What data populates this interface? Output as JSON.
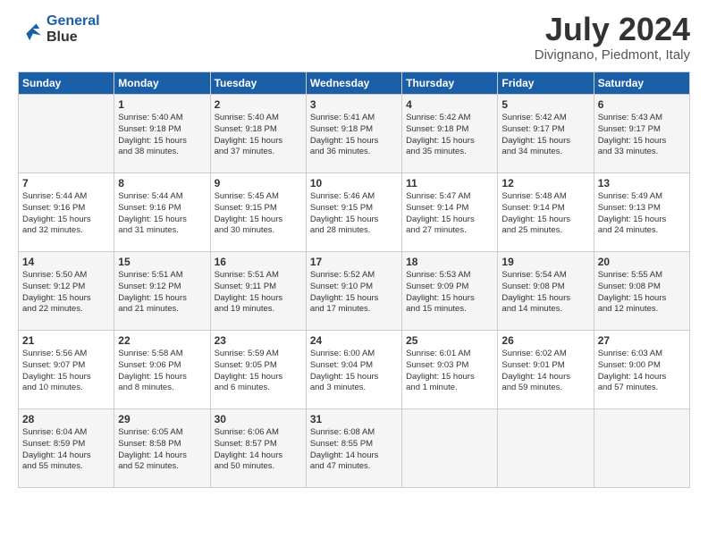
{
  "header": {
    "logo_line1": "General",
    "logo_line2": "Blue",
    "title": "July 2024",
    "location": "Divignano, Piedmont, Italy"
  },
  "days_of_week": [
    "Sunday",
    "Monday",
    "Tuesday",
    "Wednesday",
    "Thursday",
    "Friday",
    "Saturday"
  ],
  "weeks": [
    [
      {
        "day": "",
        "content": ""
      },
      {
        "day": "1",
        "content": "Sunrise: 5:40 AM\nSunset: 9:18 PM\nDaylight: 15 hours\nand 38 minutes."
      },
      {
        "day": "2",
        "content": "Sunrise: 5:40 AM\nSunset: 9:18 PM\nDaylight: 15 hours\nand 37 minutes."
      },
      {
        "day": "3",
        "content": "Sunrise: 5:41 AM\nSunset: 9:18 PM\nDaylight: 15 hours\nand 36 minutes."
      },
      {
        "day": "4",
        "content": "Sunrise: 5:42 AM\nSunset: 9:18 PM\nDaylight: 15 hours\nand 35 minutes."
      },
      {
        "day": "5",
        "content": "Sunrise: 5:42 AM\nSunset: 9:17 PM\nDaylight: 15 hours\nand 34 minutes."
      },
      {
        "day": "6",
        "content": "Sunrise: 5:43 AM\nSunset: 9:17 PM\nDaylight: 15 hours\nand 33 minutes."
      }
    ],
    [
      {
        "day": "7",
        "content": "Sunrise: 5:44 AM\nSunset: 9:16 PM\nDaylight: 15 hours\nand 32 minutes."
      },
      {
        "day": "8",
        "content": "Sunrise: 5:44 AM\nSunset: 9:16 PM\nDaylight: 15 hours\nand 31 minutes."
      },
      {
        "day": "9",
        "content": "Sunrise: 5:45 AM\nSunset: 9:15 PM\nDaylight: 15 hours\nand 30 minutes."
      },
      {
        "day": "10",
        "content": "Sunrise: 5:46 AM\nSunset: 9:15 PM\nDaylight: 15 hours\nand 28 minutes."
      },
      {
        "day": "11",
        "content": "Sunrise: 5:47 AM\nSunset: 9:14 PM\nDaylight: 15 hours\nand 27 minutes."
      },
      {
        "day": "12",
        "content": "Sunrise: 5:48 AM\nSunset: 9:14 PM\nDaylight: 15 hours\nand 25 minutes."
      },
      {
        "day": "13",
        "content": "Sunrise: 5:49 AM\nSunset: 9:13 PM\nDaylight: 15 hours\nand 24 minutes."
      }
    ],
    [
      {
        "day": "14",
        "content": "Sunrise: 5:50 AM\nSunset: 9:12 PM\nDaylight: 15 hours\nand 22 minutes."
      },
      {
        "day": "15",
        "content": "Sunrise: 5:51 AM\nSunset: 9:12 PM\nDaylight: 15 hours\nand 21 minutes."
      },
      {
        "day": "16",
        "content": "Sunrise: 5:51 AM\nSunset: 9:11 PM\nDaylight: 15 hours\nand 19 minutes."
      },
      {
        "day": "17",
        "content": "Sunrise: 5:52 AM\nSunset: 9:10 PM\nDaylight: 15 hours\nand 17 minutes."
      },
      {
        "day": "18",
        "content": "Sunrise: 5:53 AM\nSunset: 9:09 PM\nDaylight: 15 hours\nand 15 minutes."
      },
      {
        "day": "19",
        "content": "Sunrise: 5:54 AM\nSunset: 9:08 PM\nDaylight: 15 hours\nand 14 minutes."
      },
      {
        "day": "20",
        "content": "Sunrise: 5:55 AM\nSunset: 9:08 PM\nDaylight: 15 hours\nand 12 minutes."
      }
    ],
    [
      {
        "day": "21",
        "content": "Sunrise: 5:56 AM\nSunset: 9:07 PM\nDaylight: 15 hours\nand 10 minutes."
      },
      {
        "day": "22",
        "content": "Sunrise: 5:58 AM\nSunset: 9:06 PM\nDaylight: 15 hours\nand 8 minutes."
      },
      {
        "day": "23",
        "content": "Sunrise: 5:59 AM\nSunset: 9:05 PM\nDaylight: 15 hours\nand 6 minutes."
      },
      {
        "day": "24",
        "content": "Sunrise: 6:00 AM\nSunset: 9:04 PM\nDaylight: 15 hours\nand 3 minutes."
      },
      {
        "day": "25",
        "content": "Sunrise: 6:01 AM\nSunset: 9:03 PM\nDaylight: 15 hours\nand 1 minute."
      },
      {
        "day": "26",
        "content": "Sunrise: 6:02 AM\nSunset: 9:01 PM\nDaylight: 14 hours\nand 59 minutes."
      },
      {
        "day": "27",
        "content": "Sunrise: 6:03 AM\nSunset: 9:00 PM\nDaylight: 14 hours\nand 57 minutes."
      }
    ],
    [
      {
        "day": "28",
        "content": "Sunrise: 6:04 AM\nSunset: 8:59 PM\nDaylight: 14 hours\nand 55 minutes."
      },
      {
        "day": "29",
        "content": "Sunrise: 6:05 AM\nSunset: 8:58 PM\nDaylight: 14 hours\nand 52 minutes."
      },
      {
        "day": "30",
        "content": "Sunrise: 6:06 AM\nSunset: 8:57 PM\nDaylight: 14 hours\nand 50 minutes."
      },
      {
        "day": "31",
        "content": "Sunrise: 6:08 AM\nSunset: 8:55 PM\nDaylight: 14 hours\nand 47 minutes."
      },
      {
        "day": "",
        "content": ""
      },
      {
        "day": "",
        "content": ""
      },
      {
        "day": "",
        "content": ""
      }
    ]
  ]
}
